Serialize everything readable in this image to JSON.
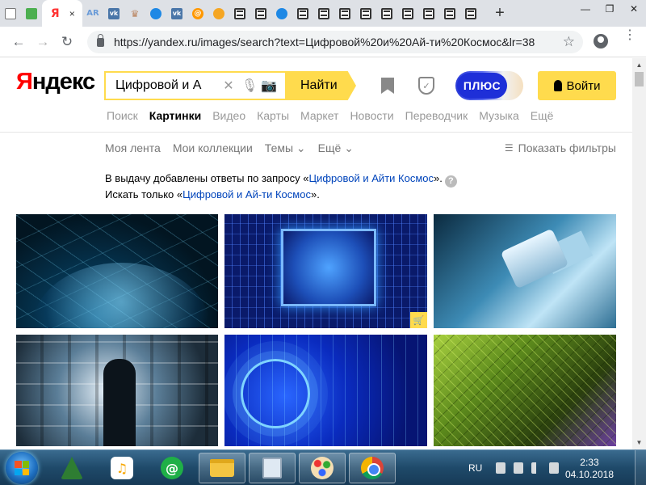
{
  "browser": {
    "active_tab_close": "×",
    "new_tab": "+",
    "url": "https://yandex.ru/images/search?text=Цифровой%20и%20Ай-ти%20Космос&lr=38",
    "window_controls": [
      "—",
      "❐",
      "✕"
    ]
  },
  "yandex": {
    "logo": "Яндекс",
    "logo_first_letter": "Я",
    "logo_rest": "ндекс",
    "search_value": "Цифровой и А",
    "find_button": "Найти",
    "plus_label": "ПЛЮС",
    "login_button": "Войти",
    "services": [
      "Поиск",
      "Картинки",
      "Видео",
      "Карты",
      "Маркет",
      "Новости",
      "Переводчик",
      "Музыка",
      "Ещё"
    ],
    "active_service": "Картинки",
    "filters": [
      "Моя лента",
      "Мои коллекции",
      "Темы ⌄",
      "Ещё ⌄"
    ],
    "show_filters": "Показать фильтры",
    "notice": {
      "line1_prefix": "В выдачу добавлены ответы по запросу «",
      "line1_link": "Цифровой и Айти Космос",
      "line1_suffix": "».",
      "line2_prefix": "Искать только «",
      "line2_link": "Цифровой и Ай-ти Космос",
      "line2_suffix": "»."
    },
    "colors": {
      "accent_yellow": "#ffdb4d",
      "link_blue": "#0044bb",
      "logo_red": "#ff0000",
      "plus_blue": "#1e2fd8"
    }
  },
  "taskbar": {
    "language": "RU",
    "time": "2:33",
    "date": "04.10.2018",
    "pinned_apps": [
      "a-app-icon",
      "music-icon",
      "mail-at-icon",
      "folder-icon",
      "notepad-icon",
      "paint-icon",
      "chrome-icon"
    ]
  }
}
